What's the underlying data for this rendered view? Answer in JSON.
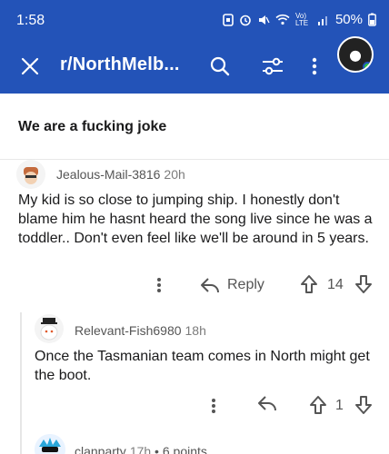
{
  "status_bar": {
    "time": "1:58",
    "battery": "50%",
    "icons": [
      "notification-icon",
      "alarm-icon",
      "mute-icon",
      "wifi-icon",
      "volte-icon",
      "signal-icon"
    ],
    "network_label": "Vo) LTE"
  },
  "app_bar": {
    "subreddit": "r/NorthMelb...",
    "icons": [
      "close-icon",
      "search-icon",
      "filter-icon",
      "more-icon",
      "avatar"
    ],
    "colors": {
      "background": "#2353b8",
      "online": "#27c93f"
    }
  },
  "post": {
    "title": "We are a fucking joke"
  },
  "comments": [
    {
      "author": "Jealous-Mail-3816",
      "time": "20h",
      "body": "My kid is so close to jumping ship. I honestly don't blame him he hasnt heard the song live since he was a toddler.. Don't even feel like we'll be around in 5 years.",
      "reply_label": "Reply",
      "score": "14"
    },
    {
      "author": "Relevant-Fish6980",
      "time": "18h",
      "body": "Once the Tasmanian team comes in North might get the boot.",
      "score": "1"
    },
    {
      "author": "clanparty",
      "time": "17h",
      "extra": "6 points"
    }
  ]
}
